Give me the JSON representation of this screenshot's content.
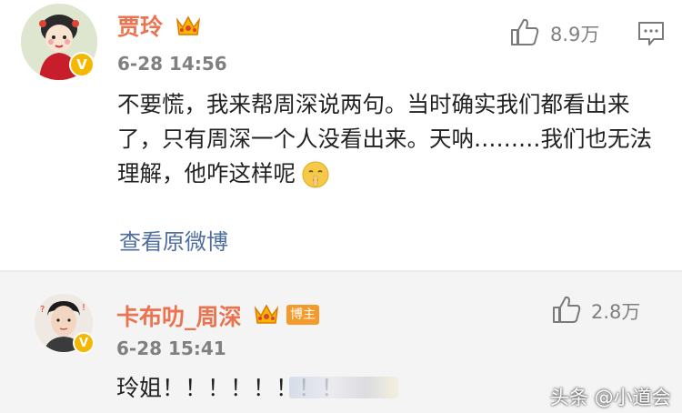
{
  "comments": [
    {
      "author": "贾玲",
      "time": "6-28 14:56",
      "likes": "8.9万",
      "text": "不要慌，我来帮周深说两句。当时确实我们都看出来了，只有周深一个人没看出来。天呐………我们也无法理解，他咋这样呢",
      "view_link": "查看原微博"
    },
    {
      "author": "卡布叻_周深",
      "role_tag": "博主",
      "time": "6-28 15:41",
      "likes": "2.8万",
      "text": "玲姐！！！！！！！！"
    }
  ],
  "watermark": "头条 @小道会",
  "icons": {
    "verified_badge": "verified-v-icon",
    "member_crown": "crown-icon",
    "like": "thumbs-up-icon",
    "reply": "comment-bubble-icon",
    "emoji": "shush-face-emoji-icon"
  },
  "colors": {
    "author_name": "#eb7350",
    "link": "#4e6ea1",
    "meta_text": "#808080",
    "verified": "#f5b800",
    "role_tag": "#f49a2a",
    "reply_bg": "#f4f4f4"
  }
}
